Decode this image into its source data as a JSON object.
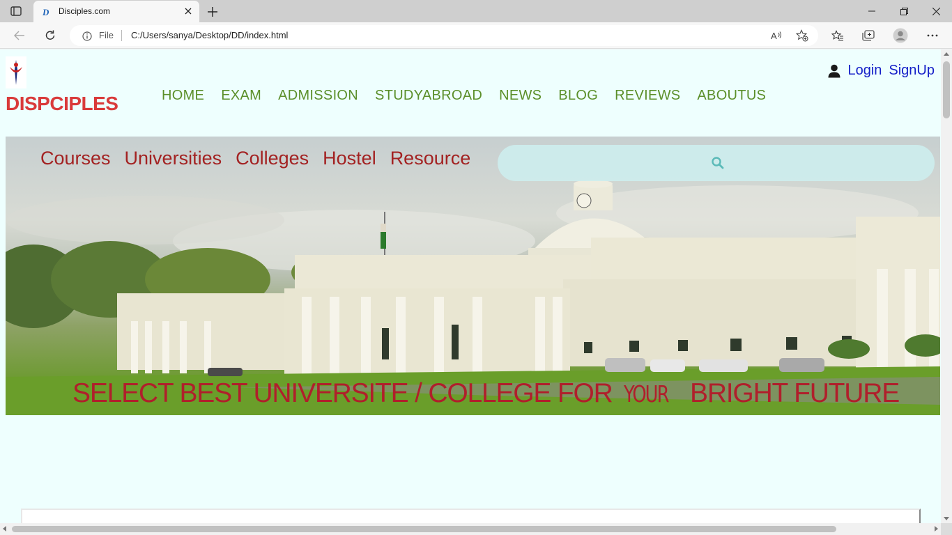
{
  "browser": {
    "tab_title": "Disciples.com",
    "omnibox_scheme": "File",
    "url": "C:/Users/sanya/Desktop/DD/index.html"
  },
  "site": {
    "brand": "DISPCIPLES",
    "nav": [
      "HOME",
      "EXAM",
      "ADMISSION",
      "STUDYABROAD",
      "NEWS",
      "BLOG",
      "REVIEWS",
      "ABOUTUS"
    ],
    "auth": {
      "login": "Login",
      "signup": "SignUp"
    },
    "subnav": [
      "Courses",
      "Universities",
      "Colleges",
      "Hostel",
      "Resource"
    ],
    "search": {
      "placeholder": "",
      "icon": "search-icon"
    },
    "tagline_part1": "SELECT BEST UNIVERSITE / COLLEGE FOR",
    "tagline_your": "YOUR",
    "tagline_part2": "BRIGHT FUTURE"
  },
  "colors": {
    "page_bg": "#eefffe",
    "brand": "#d93a3a",
    "nav": "#5b8f2a",
    "auth": "#1520c8",
    "subnav": "#a32222",
    "tagline": "#b01f2b"
  }
}
